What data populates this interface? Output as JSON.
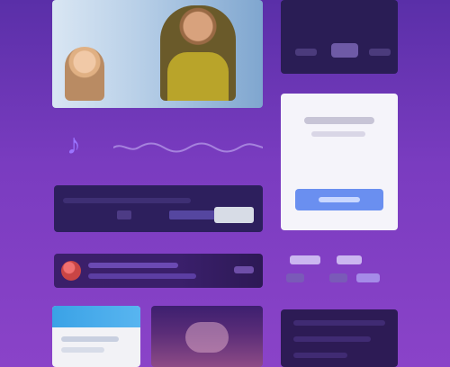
{
  "page": {
    "background": [
      "#5a2fa8",
      "#7a3cc0",
      "#8a43c8"
    ]
  },
  "hero": {
    "icon_left": "person-icon",
    "icon_right": "person-icon"
  },
  "audio": {
    "icon": "music-note-icon",
    "accent": "#9a74ff"
  },
  "player": {
    "icon_action": "play-icon",
    "primary_button_color": "#d7dce6"
  },
  "track": {
    "avatar_color": "#c94545"
  },
  "right": {
    "form_button_color": "#6a8ff0"
  }
}
